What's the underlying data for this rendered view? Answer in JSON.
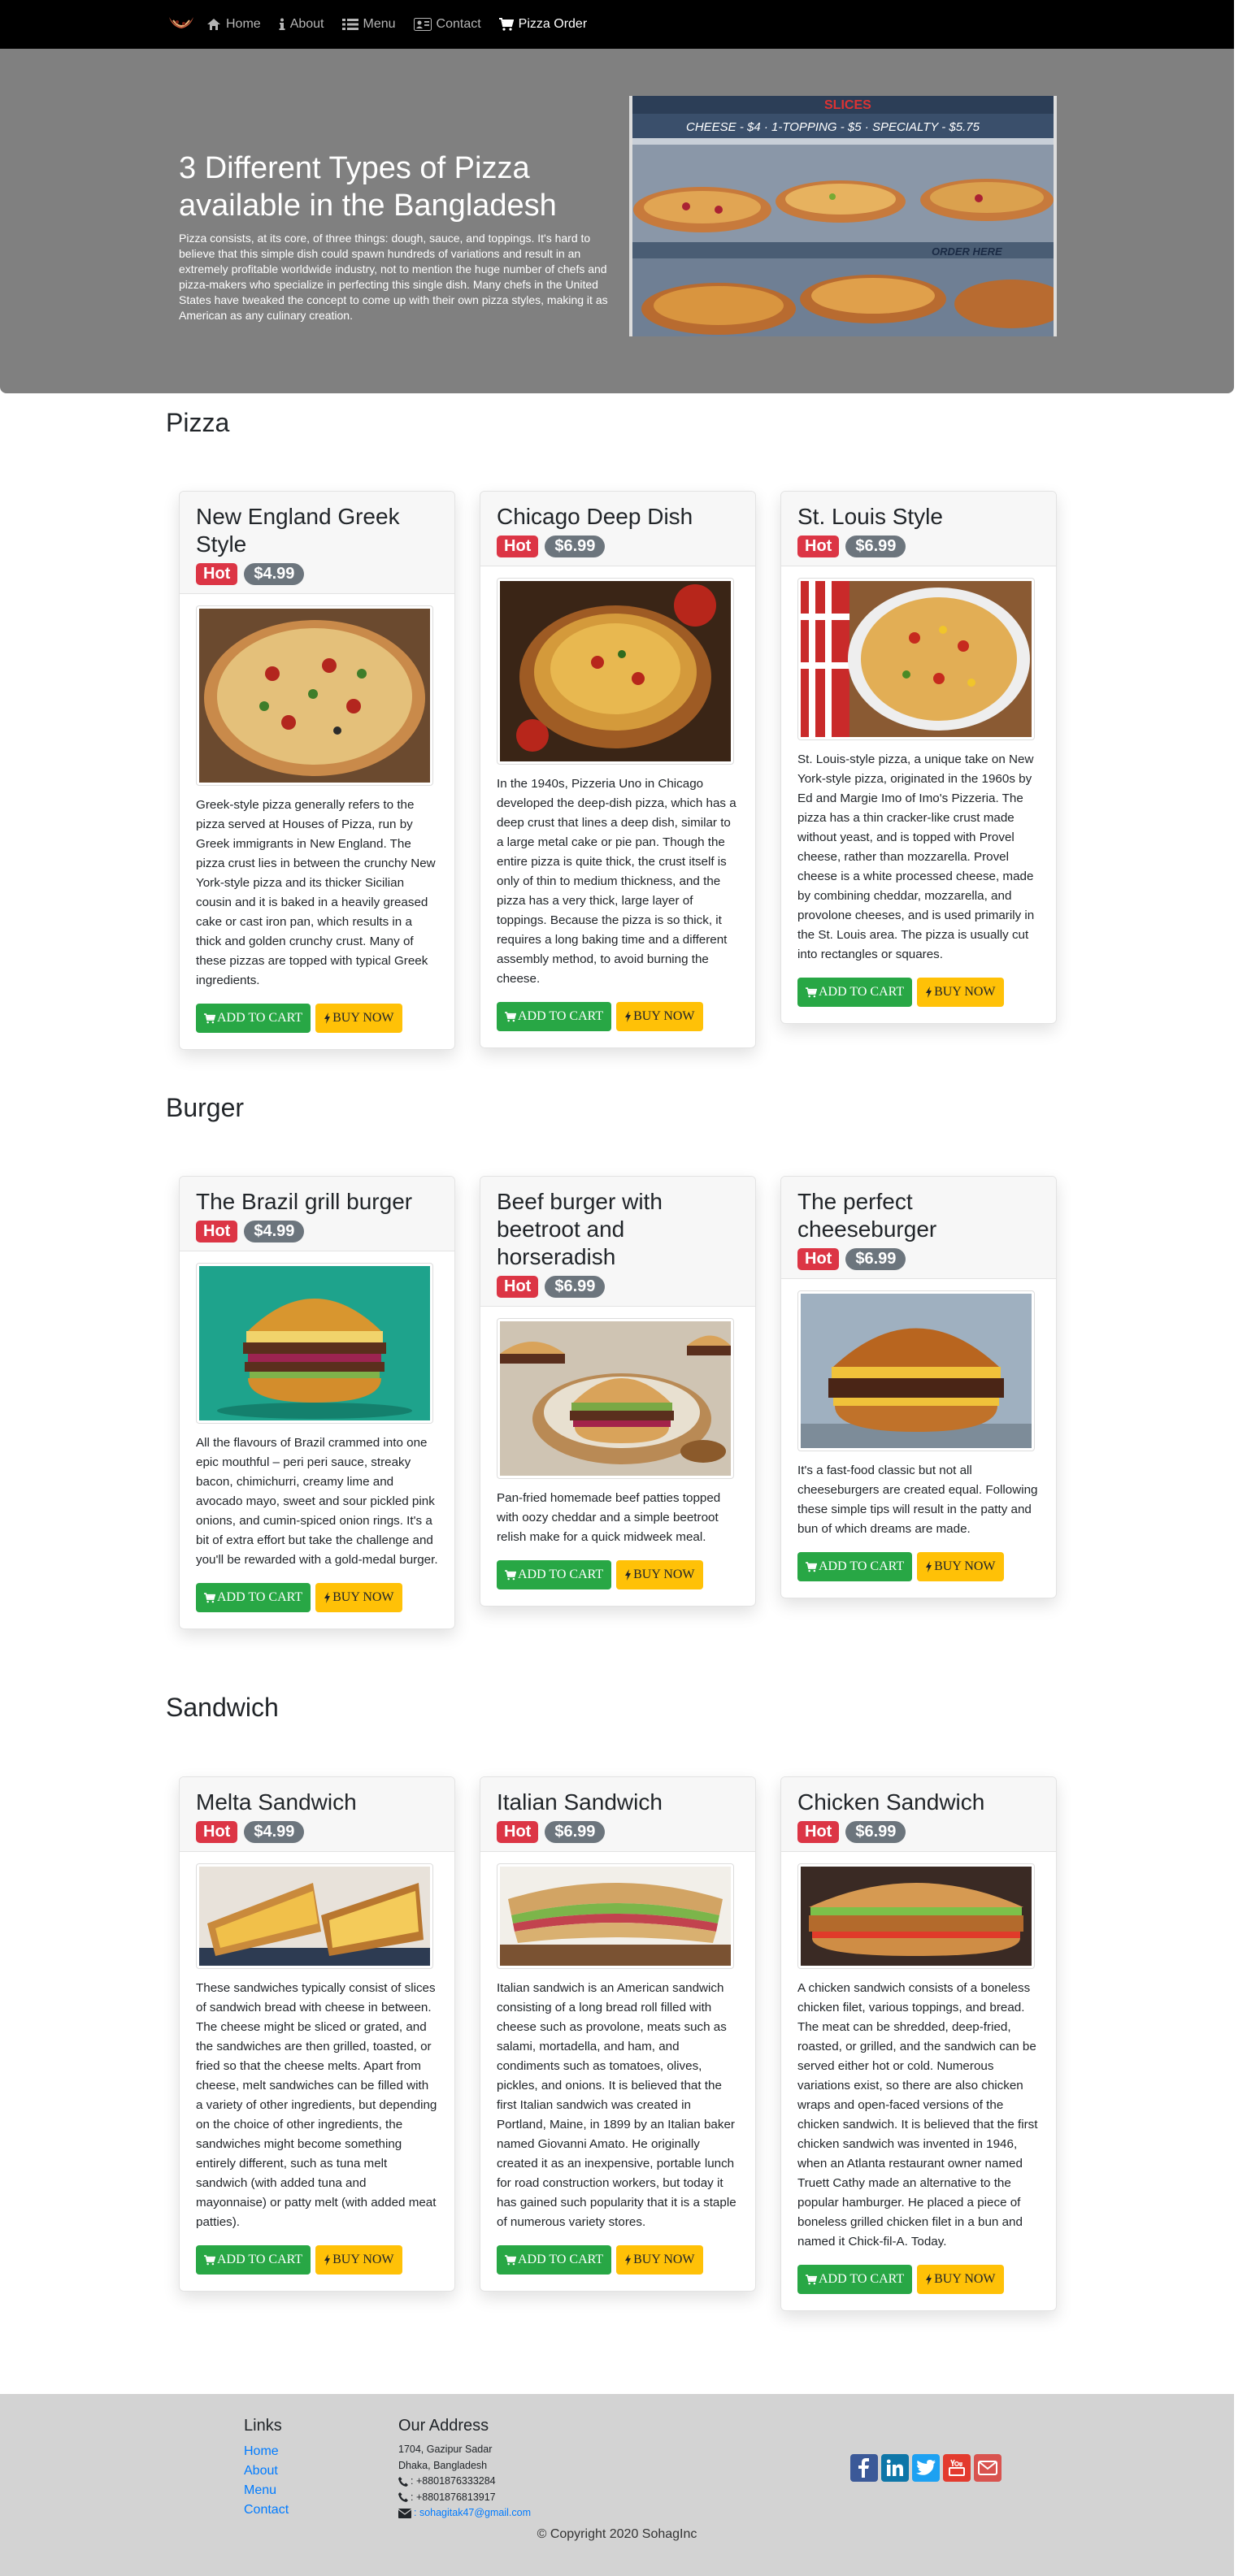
{
  "nav": {
    "items": [
      {
        "label": "Home",
        "icon": "home-icon"
      },
      {
        "label": "About",
        "icon": "info-icon"
      },
      {
        "label": "Menu",
        "icon": "list-icon"
      },
      {
        "label": "Contact",
        "icon": "contact-card-icon"
      },
      {
        "label": "Pizza Order",
        "icon": "cart-icon"
      }
    ]
  },
  "hero": {
    "title": "3 Different Types of Pizza available in the Bangladesh",
    "text": "Pizza consists, at its core, of three things: dough, sauce, and toppings. It's hard to believe that this simple dish could spawn hundreds of variations and result in an extremely profitable worldwide industry, not to mention the huge number of chefs and pizza-makers who specialize in perfecting this single dish. Many chefs in the United States have tweaked the concept to come up with their own pizza styles, making it as American as any culinary creation.",
    "image": {
      "sign_top": "SLICES",
      "sign_prices": "CHEESE - $4 · 1-TOPPING - $5 · SPECIALTY - $5.75",
      "sign_order": "ORDER HERE"
    }
  },
  "sections": [
    {
      "title": "Pizza",
      "items": [
        {
          "name": "New England Greek Style",
          "badge": "Hot",
          "price": "$4.99",
          "text": "Greek-style pizza generally refers to the pizza served at Houses of Pizza, run by Greek immigrants in New England. The pizza crust lies in between the crunchy New York-style pizza and its thicker Sicilian cousin and it is baked in a heavily greased cake or cast iron pan, which results in a thick and golden crunchy crust. Many of these pizzas are topped with typical Greek ingredients."
        },
        {
          "name": "Chicago Deep Dish",
          "badge": "Hot",
          "price": "$6.99",
          "text": "In the 1940s, Pizzeria Uno in Chicago developed the deep-dish pizza, which has a deep crust that lines a deep dish, similar to a large metal cake or pie pan. Though the entire pizza is quite thick, the crust itself is only of thin to medium thickness, and the pizza has a very thick, large layer of toppings. Because the pizza is so thick, it requires a long baking time and a different assembly method, to avoid burning the cheese."
        },
        {
          "name": "St. Louis Style",
          "badge": "Hot",
          "price": "$6.99",
          "text": "St. Louis-style pizza, a unique take on New York-style pizza, originated in the 1960s by Ed and Margie Imo of Imo's Pizzeria. The pizza has a thin cracker-like crust made without yeast, and is topped with Provel cheese, rather than mozzarella. Provel cheese is a white processed cheese, made by combining cheddar, mozzarella, and provolone cheeses, and is used primarily in the St. Louis area. The pizza is usually cut into rectangles or squares."
        }
      ]
    },
    {
      "title": "Burger",
      "items": [
        {
          "name": "The Brazil grill burger",
          "badge": "Hot",
          "price": "$4.99",
          "text": "All the flavours of Brazil crammed into one epic mouthful – peri peri sauce, streaky bacon, chimichurri, creamy lime and avocado mayo, sweet and sour pickled pink onions, and cumin-spiced onion rings. It's a bit of extra effort but take the challenge and you'll be rewarded with a gold-medal burger."
        },
        {
          "name": "Beef burger with beetroot and horseradish",
          "badge": "Hot",
          "price": "$6.99",
          "text": "Pan-fried homemade beef patties topped with oozy cheddar and a simple beetroot relish make for a quick midweek meal."
        },
        {
          "name": "The perfect cheeseburger",
          "badge": "Hot",
          "price": "$6.99",
          "text": "It's a fast-food classic but not all cheeseburgers are created equal. Following these simple tips will result in the patty and bun of which dreams are made."
        }
      ]
    },
    {
      "title": "Sandwich",
      "items": [
        {
          "name": "Melta Sandwich",
          "badge": "Hot",
          "price": "$4.99",
          "text": "These sandwiches typically consist of slices of sandwich bread with cheese in between. The cheese might be sliced or grated, and the sandwiches are then grilled, toasted, or fried so that the cheese melts. Apart from cheese, melt sandwiches can be filled with a variety of other ingredients, but depending on the choice of other ingredients, the sandwiches might become something entirely different, such as tuna melt sandwich (with added tuna and mayonnaise) or patty melt (with added meat patties)."
        },
        {
          "name": "Italian Sandwich",
          "badge": "Hot",
          "price": "$6.99",
          "text": "Italian sandwich is an American sandwich consisting of a long bread roll filled with cheese such as provolone, meats such as salami, mortadella, and ham, and condiments such as tomatoes, olives, pickles, and onions. It is believed that the first Italian sandwich was created in Portland, Maine, in 1899 by an Italian baker named Giovanni Amato. He originally created it as an inexpensive, portable lunch for road construction workers, but today it has gained such popularity that it is a staple of numerous variety stores."
        },
        {
          "name": "Chicken Sandwich",
          "badge": "Hot",
          "price": "$6.99",
          "text": "A chicken sandwich consists of a boneless chicken filet, various toppings, and bread. The meat can be shredded, deep-fried, roasted, or grilled, and the sandwich can be served either hot or cold. Numerous variations exist, so there are also chicken wraps and open-faced versions of the chicken sandwich. It is believed that the first chicken sandwich was invented in 1946, when an Atlanta restaurant owner named Truett Cathy made an alternative to the popular hamburger. He placed a piece of boneless grilled chicken filet in a bun and named it Chick-fil-A. Today."
        }
      ]
    }
  ],
  "buttons": {
    "add_to_cart": "ADD TO CART",
    "buy_now": "BUY NOW"
  },
  "footer": {
    "links_title": "Links",
    "links": [
      "Home",
      "About",
      "Menu",
      "Contact"
    ],
    "address_title": "Our Address",
    "address_lines": [
      "1704, Gazipur Sadar",
      "Dhaka, Bangladesh"
    ],
    "phones": [
      ": +8801876333284",
      ": +8801876813917"
    ],
    "email": ": sohagitak47@gmail.com",
    "socials": [
      {
        "name": "facebook-icon",
        "color": "#3b5998"
      },
      {
        "name": "linkedin-icon",
        "color": "#0e76a8"
      },
      {
        "name": "twitter-icon",
        "color": "#1da1f2"
      },
      {
        "name": "youtube-icon",
        "color": "#e33b2e"
      },
      {
        "name": "mail-icon",
        "color": "#d9534f"
      }
    ],
    "copyright": "© Copyright 2020 SohagInc"
  },
  "colors": {
    "hot": "#dc3545",
    "price": "#6c757d",
    "cart": "#28a745",
    "buy": "#ffc107",
    "link": "#007bff",
    "hero": "#808080",
    "footer": "#d3d3d3"
  }
}
